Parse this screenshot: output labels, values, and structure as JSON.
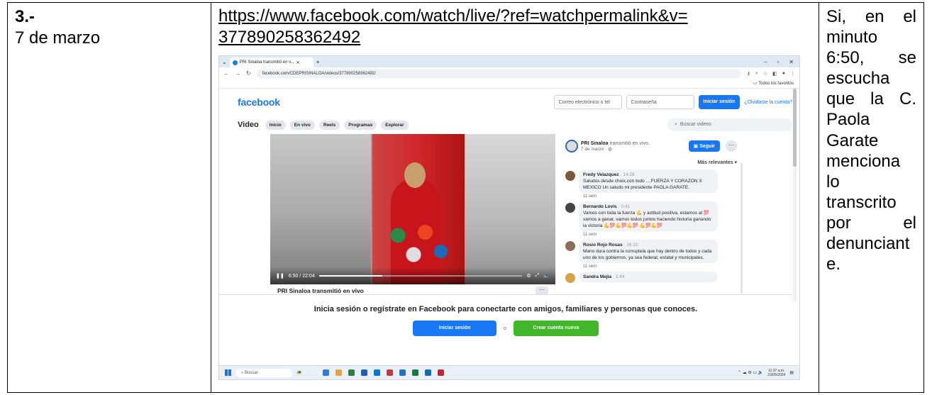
{
  "row": {
    "number": "3.-",
    "date": "7 de marzo",
    "link_line1": "https://www.facebook.com/watch/live/?ref=watchpermalink&v=",
    "link_line2": "377890258362492",
    "observation_lines": [
      [
        "Si,",
        "en",
        "el"
      ],
      [
        "minuto"
      ],
      [
        "6:50,",
        "se"
      ],
      [
        "escucha"
      ],
      [
        "que",
        "la",
        "C."
      ],
      [
        "Paola"
      ],
      [
        "Garate"
      ],
      [
        "menciona"
      ],
      [
        "lo"
      ],
      [
        "transcrito"
      ],
      [
        "por",
        "el"
      ],
      [
        "denunciant"
      ],
      [
        "e."
      ]
    ]
  },
  "screenshot": {
    "browser": {
      "tab_title": "PRI Sinaloa transmitió en v...",
      "url": "facebook.com/CDEPRISINALOA/videos/377890258362492/",
      "bookmarks_label": "Todos los favoritos"
    },
    "facebook": {
      "logo": "facebook",
      "email_placeholder": "Correo electrónico o tel",
      "password_placeholder": "Contraseña",
      "login_button": "Iniciar sesión",
      "forgot_link": "¿Olvidaste la cuenta?",
      "video_heading": "Video",
      "nav_pills": [
        "Inicio",
        "En vivo",
        "Reels",
        "Programas",
        "Explorar"
      ],
      "search_placeholder": "Buscar videos",
      "video_time": "6:50 / 22:04",
      "video_progress": 0.31,
      "caption": "PRI Sinaloa transmitió en vivo",
      "caption_more": "···",
      "post_name": "PRI Sinaloa",
      "post_action": "transmitió en vivo.",
      "post_date": "7 de marzo · ",
      "follow_button": "Seguir",
      "sort_label": "Más relevantes ▾",
      "comments": [
        {
          "name": "Fredy Velazquez",
          "time": "· 14:26",
          "text": "Saludos desde choix,con todo ....FUERZA Y CORAZON X MEXICO Un saludo mi presidente PAOLA GARATE.",
          "meta": "11 sem"
        },
        {
          "name": "Bernardo Lovis",
          "time": "· 0:41",
          "text": "Vamos con toda la fuerza 💪 y actitud positiva, estamos al 💯 vamos a ganar, vamos todos juntos haciendo historia ganando la victoria 💪💯💪💯💪💯 💪💯💪💯",
          "meta": "11 sem"
        },
        {
          "name": "Rosio Rojo Rosas",
          "time": "· 16:10",
          "text": "Mano dura contra la corruptela que hay dentro de todos y cada uno de los gobiernos, ya sea federal, estatal y municipales.",
          "meta": "11 sem"
        },
        {
          "name": "Sandra Mejia",
          "time": "· 1:44",
          "text": "",
          "meta": ""
        }
      ],
      "banner_text": "Inicia sesión o regístrate en Facebook para conectarte con amigos, familiares y personas que conoces.",
      "banner_login": "Iniciar sesión",
      "banner_or": "o",
      "banner_create": "Crear cuenta nueva"
    },
    "taskbar": {
      "search": "Buscar",
      "time": "11:37 a.m.",
      "date": "23/05/2024",
      "app_colors": [
        "#2b7be4",
        "#e8a33a",
        "#2d7d46",
        "#1b5ebe",
        "#0078d4",
        "#c23b3b",
        "#1f74c8",
        "#107c41",
        "#0f6cbd",
        "#c4262e"
      ]
    }
  }
}
